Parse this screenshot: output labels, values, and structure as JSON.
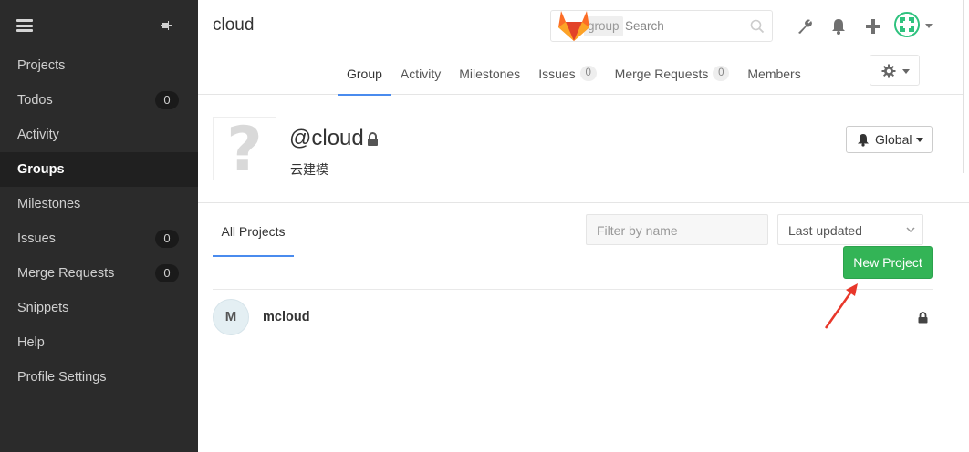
{
  "sidebar": {
    "items": [
      {
        "label": "Projects"
      },
      {
        "label": "Todos",
        "count": "0"
      },
      {
        "label": "Activity"
      },
      {
        "label": "Groups"
      },
      {
        "label": "Milestones"
      },
      {
        "label": "Issues",
        "count": "0"
      },
      {
        "label": "Merge Requests",
        "count": "0"
      },
      {
        "label": "Snippets"
      },
      {
        "label": "Help"
      },
      {
        "label": "Profile Settings"
      }
    ],
    "active": "Groups"
  },
  "header": {
    "title": "cloud",
    "search": {
      "scope": "group",
      "placeholder": "Search"
    },
    "tabs": [
      {
        "label": "Group"
      },
      {
        "label": "Activity"
      },
      {
        "label": "Milestones"
      },
      {
        "label": "Issues",
        "count": "0"
      },
      {
        "label": "Merge Requests",
        "count": "0"
      },
      {
        "label": "Members"
      }
    ],
    "active_tab": "Group"
  },
  "group": {
    "avatar_placeholder": "?",
    "name": "@cloud",
    "description": "云建模",
    "notification_label": "Global"
  },
  "projects": {
    "tab_label": "All Projects",
    "filter_placeholder": "Filter by name",
    "sort_value": "Last updated",
    "new_button": "New Project",
    "list": [
      {
        "initial": "M",
        "name": "mcloud",
        "visibility": "private"
      }
    ]
  },
  "colors": {
    "sidebar_bg": "#2b2b2b",
    "accent": "#4a8bee",
    "new_button": "#33b456",
    "annotation_arrow": "#e8372a"
  }
}
